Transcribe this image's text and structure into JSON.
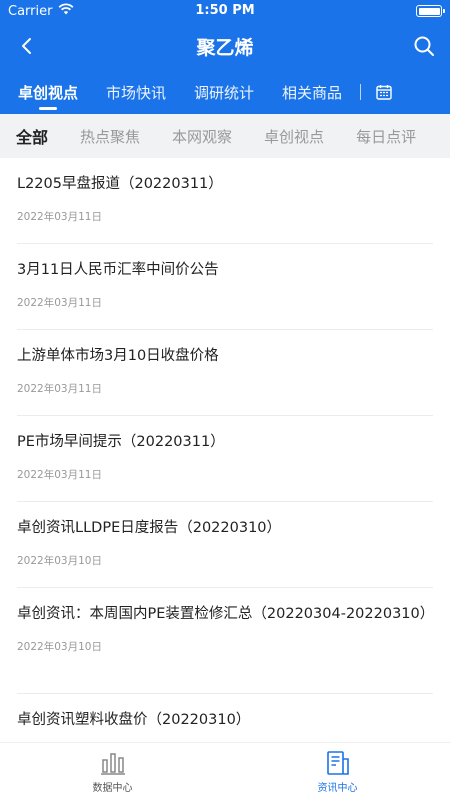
{
  "status_bar": {
    "carrier": "Carrier",
    "time": "1:50 PM"
  },
  "nav": {
    "title": "聚乙烯"
  },
  "category_tabs": [
    {
      "label": "卓创视点",
      "active": true
    },
    {
      "label": "市场快讯",
      "active": false
    },
    {
      "label": "调研统计",
      "active": false
    },
    {
      "label": "相关商品",
      "active": false
    }
  ],
  "sub_tabs": [
    {
      "label": "全部",
      "active": true
    },
    {
      "label": "热点聚焦",
      "active": false
    },
    {
      "label": "本网观察",
      "active": false
    },
    {
      "label": "卓创视点",
      "active": false
    },
    {
      "label": "每日点评",
      "active": false
    }
  ],
  "news": [
    {
      "title": "L2205早盘报道（20220311）",
      "date": "2022年03月11日"
    },
    {
      "title": "3月11日人民币汇率中间价公告",
      "date": "2022年03月11日"
    },
    {
      "title": "上游单体市场3月10日收盘价格",
      "date": "2022年03月11日"
    },
    {
      "title": "PE市场早间提示（20220311）",
      "date": "2022年03月11日"
    },
    {
      "title": "卓创资讯LLDPE日度报告（20220310）",
      "date": "2022年03月10日"
    },
    {
      "title": "卓创资讯：本周国内PE装置检修汇总（20220304-20220310）",
      "date": "2022年03月10日"
    },
    {
      "title": "卓创资讯塑料收盘价（20220310）",
      "date": ""
    }
  ],
  "tab_bar": [
    {
      "label": "数据中心",
      "icon": "bar-chart-icon",
      "active": false
    },
    {
      "label": "资讯中心",
      "icon": "news-icon",
      "active": true
    }
  ],
  "colors": {
    "primary": "#1a73e8",
    "subtab_bg": "#f1f2f4"
  }
}
